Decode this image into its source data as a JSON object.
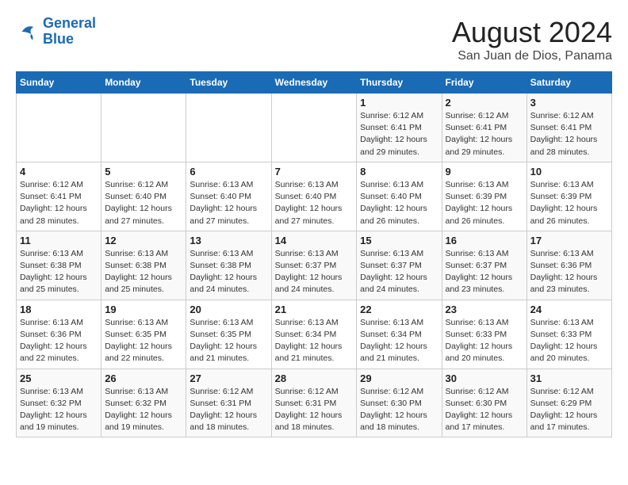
{
  "logo": {
    "line1": "General",
    "line2": "Blue"
  },
  "title": "August 2024",
  "location": "San Juan de Dios, Panama",
  "days_of_week": [
    "Sunday",
    "Monday",
    "Tuesday",
    "Wednesday",
    "Thursday",
    "Friday",
    "Saturday"
  ],
  "weeks": [
    [
      {
        "num": "",
        "detail": ""
      },
      {
        "num": "",
        "detail": ""
      },
      {
        "num": "",
        "detail": ""
      },
      {
        "num": "",
        "detail": ""
      },
      {
        "num": "1",
        "detail": "Sunrise: 6:12 AM\nSunset: 6:41 PM\nDaylight: 12 hours\nand 29 minutes."
      },
      {
        "num": "2",
        "detail": "Sunrise: 6:12 AM\nSunset: 6:41 PM\nDaylight: 12 hours\nand 29 minutes."
      },
      {
        "num": "3",
        "detail": "Sunrise: 6:12 AM\nSunset: 6:41 PM\nDaylight: 12 hours\nand 28 minutes."
      }
    ],
    [
      {
        "num": "4",
        "detail": "Sunrise: 6:12 AM\nSunset: 6:41 PM\nDaylight: 12 hours\nand 28 minutes."
      },
      {
        "num": "5",
        "detail": "Sunrise: 6:12 AM\nSunset: 6:40 PM\nDaylight: 12 hours\nand 27 minutes."
      },
      {
        "num": "6",
        "detail": "Sunrise: 6:13 AM\nSunset: 6:40 PM\nDaylight: 12 hours\nand 27 minutes."
      },
      {
        "num": "7",
        "detail": "Sunrise: 6:13 AM\nSunset: 6:40 PM\nDaylight: 12 hours\nand 27 minutes."
      },
      {
        "num": "8",
        "detail": "Sunrise: 6:13 AM\nSunset: 6:40 PM\nDaylight: 12 hours\nand 26 minutes."
      },
      {
        "num": "9",
        "detail": "Sunrise: 6:13 AM\nSunset: 6:39 PM\nDaylight: 12 hours\nand 26 minutes."
      },
      {
        "num": "10",
        "detail": "Sunrise: 6:13 AM\nSunset: 6:39 PM\nDaylight: 12 hours\nand 26 minutes."
      }
    ],
    [
      {
        "num": "11",
        "detail": "Sunrise: 6:13 AM\nSunset: 6:38 PM\nDaylight: 12 hours\nand 25 minutes."
      },
      {
        "num": "12",
        "detail": "Sunrise: 6:13 AM\nSunset: 6:38 PM\nDaylight: 12 hours\nand 25 minutes."
      },
      {
        "num": "13",
        "detail": "Sunrise: 6:13 AM\nSunset: 6:38 PM\nDaylight: 12 hours\nand 24 minutes."
      },
      {
        "num": "14",
        "detail": "Sunrise: 6:13 AM\nSunset: 6:37 PM\nDaylight: 12 hours\nand 24 minutes."
      },
      {
        "num": "15",
        "detail": "Sunrise: 6:13 AM\nSunset: 6:37 PM\nDaylight: 12 hours\nand 24 minutes."
      },
      {
        "num": "16",
        "detail": "Sunrise: 6:13 AM\nSunset: 6:37 PM\nDaylight: 12 hours\nand 23 minutes."
      },
      {
        "num": "17",
        "detail": "Sunrise: 6:13 AM\nSunset: 6:36 PM\nDaylight: 12 hours\nand 23 minutes."
      }
    ],
    [
      {
        "num": "18",
        "detail": "Sunrise: 6:13 AM\nSunset: 6:36 PM\nDaylight: 12 hours\nand 22 minutes."
      },
      {
        "num": "19",
        "detail": "Sunrise: 6:13 AM\nSunset: 6:35 PM\nDaylight: 12 hours\nand 22 minutes."
      },
      {
        "num": "20",
        "detail": "Sunrise: 6:13 AM\nSunset: 6:35 PM\nDaylight: 12 hours\nand 21 minutes."
      },
      {
        "num": "21",
        "detail": "Sunrise: 6:13 AM\nSunset: 6:34 PM\nDaylight: 12 hours\nand 21 minutes."
      },
      {
        "num": "22",
        "detail": "Sunrise: 6:13 AM\nSunset: 6:34 PM\nDaylight: 12 hours\nand 21 minutes."
      },
      {
        "num": "23",
        "detail": "Sunrise: 6:13 AM\nSunset: 6:33 PM\nDaylight: 12 hours\nand 20 minutes."
      },
      {
        "num": "24",
        "detail": "Sunrise: 6:13 AM\nSunset: 6:33 PM\nDaylight: 12 hours\nand 20 minutes."
      }
    ],
    [
      {
        "num": "25",
        "detail": "Sunrise: 6:13 AM\nSunset: 6:32 PM\nDaylight: 12 hours\nand 19 minutes."
      },
      {
        "num": "26",
        "detail": "Sunrise: 6:13 AM\nSunset: 6:32 PM\nDaylight: 12 hours\nand 19 minutes."
      },
      {
        "num": "27",
        "detail": "Sunrise: 6:12 AM\nSunset: 6:31 PM\nDaylight: 12 hours\nand 18 minutes."
      },
      {
        "num": "28",
        "detail": "Sunrise: 6:12 AM\nSunset: 6:31 PM\nDaylight: 12 hours\nand 18 minutes."
      },
      {
        "num": "29",
        "detail": "Sunrise: 6:12 AM\nSunset: 6:30 PM\nDaylight: 12 hours\nand 18 minutes."
      },
      {
        "num": "30",
        "detail": "Sunrise: 6:12 AM\nSunset: 6:30 PM\nDaylight: 12 hours\nand 17 minutes."
      },
      {
        "num": "31",
        "detail": "Sunrise: 6:12 AM\nSunset: 6:29 PM\nDaylight: 12 hours\nand 17 minutes."
      }
    ]
  ]
}
